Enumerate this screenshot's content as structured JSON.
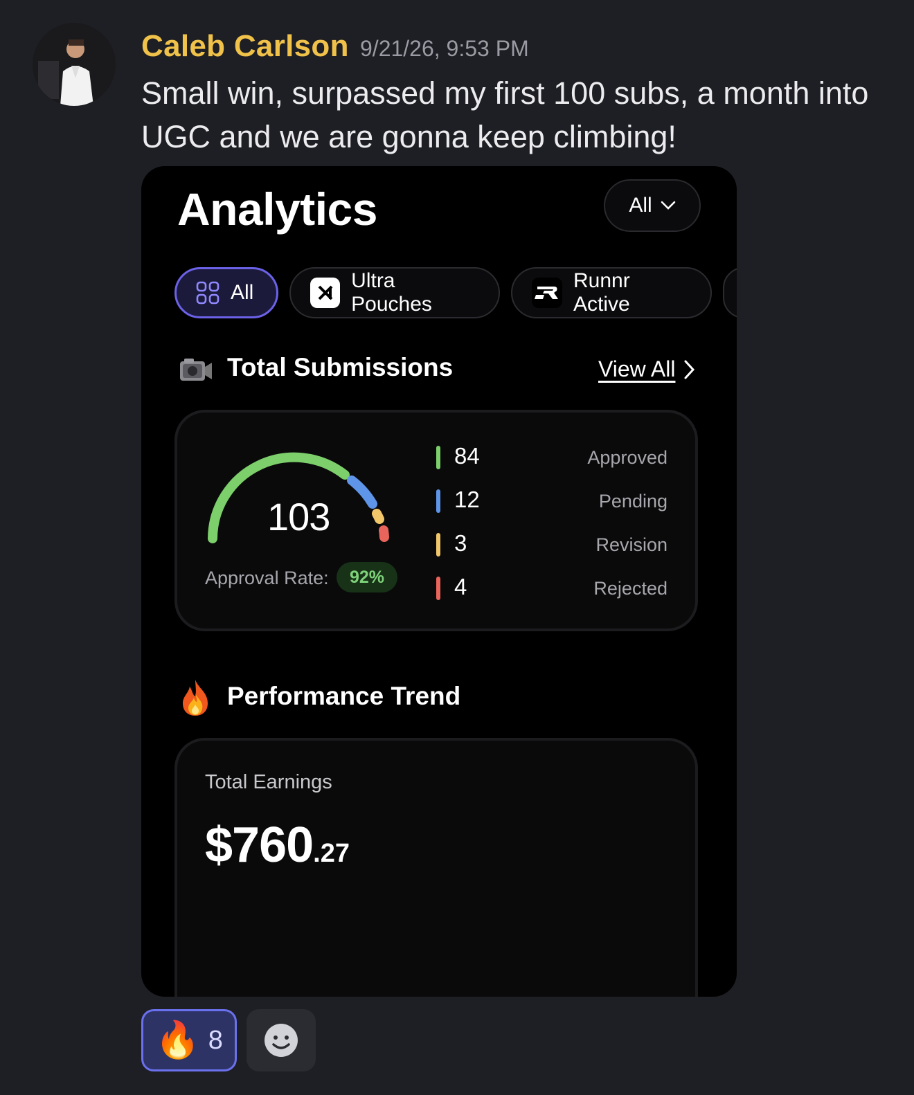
{
  "message": {
    "author": "Caleb Carlson",
    "timestamp": "9/21/26, 9:53 PM",
    "text": "Small win, surpassed my first 100 subs, a month into UGC and we are gonna keep climbing!"
  },
  "analytics": {
    "title": "Analytics",
    "filter_value": "All",
    "chips": [
      {
        "label": "All",
        "icon": "grid-icon",
        "active": true
      },
      {
        "label": "Ultra Pouches",
        "icon": "ultra-pouches-logo-icon",
        "active": false
      },
      {
        "label": "Runnr Active",
        "icon": "runnr-logo-icon",
        "active": false
      }
    ],
    "submissions": {
      "title": "Total Submissions",
      "view_all": "View All",
      "total": "103",
      "approval_label": "Approval Rate:",
      "approval_rate": "92%",
      "stats": [
        {
          "value": "84",
          "label": "Approved",
          "color": "#7ccf6a"
        },
        {
          "value": "12",
          "label": "Pending",
          "color": "#5f95e8"
        },
        {
          "value": "3",
          "label": "Revision",
          "color": "#f2c76a"
        },
        {
          "value": "4",
          "label": "Rejected",
          "color": "#e9655b"
        }
      ]
    },
    "performance": {
      "title": "Performance Trend",
      "earnings_label": "Total Earnings",
      "earnings_main": "$760",
      "earnings_cents": ".27"
    }
  },
  "reactions": {
    "fire_emoji": "🔥",
    "fire_count": "8"
  }
}
